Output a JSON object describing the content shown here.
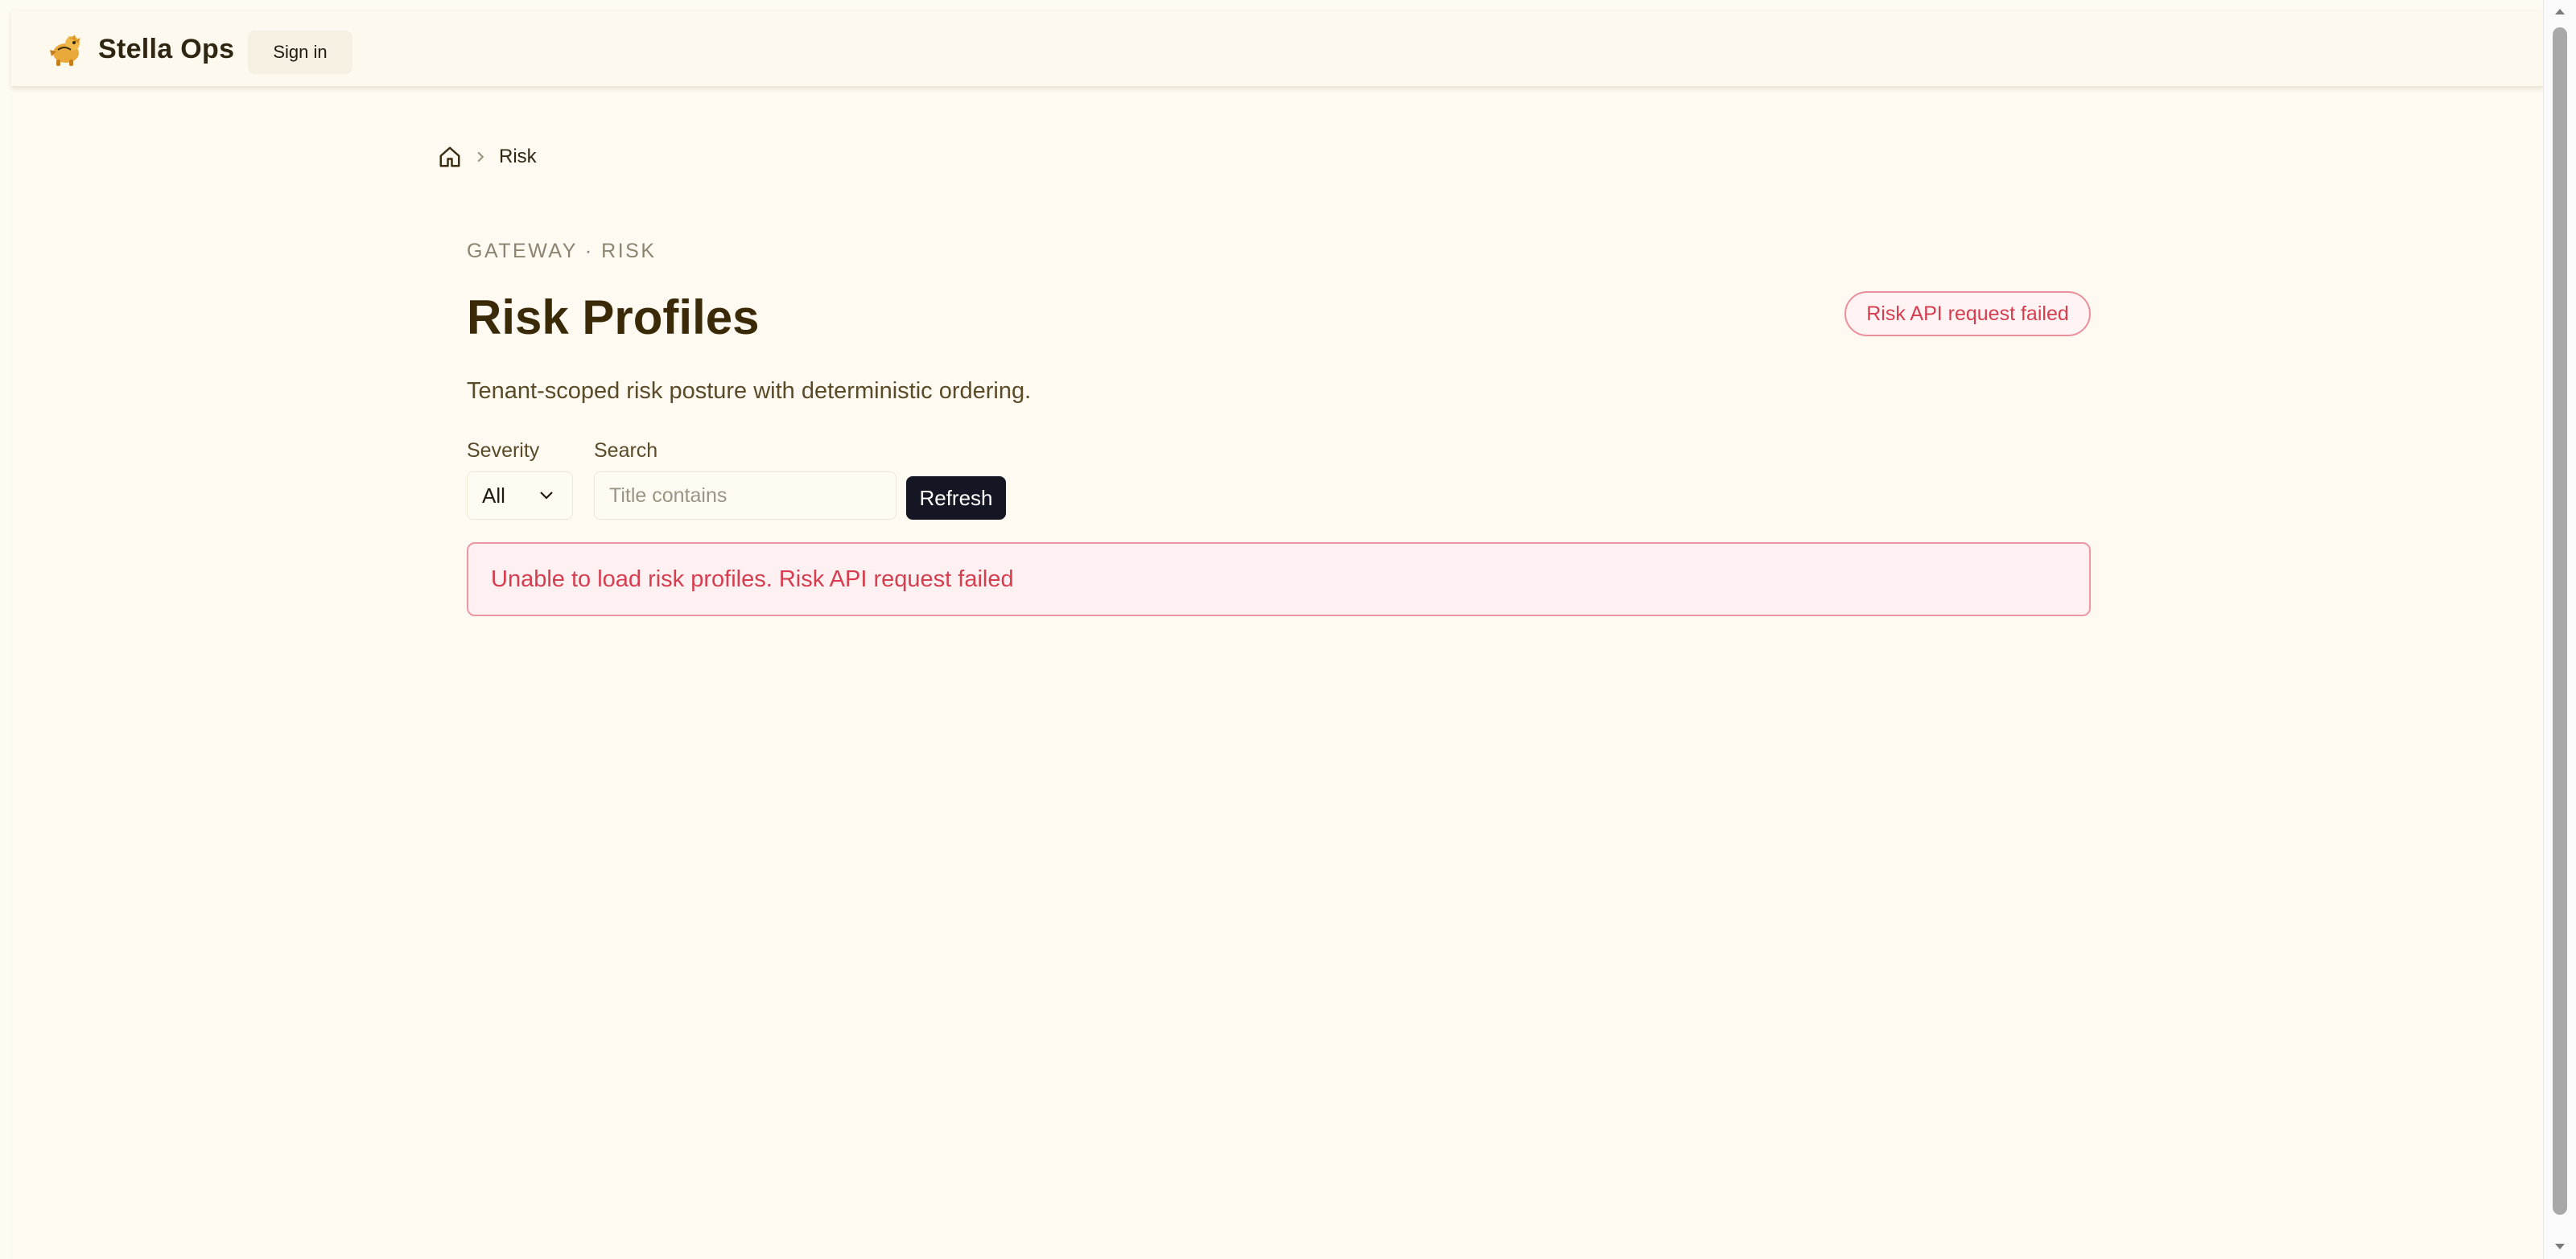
{
  "header": {
    "brand_name": "Stella Ops",
    "brand_icon": "mascot-logo-icon",
    "signin_label": "Sign in"
  },
  "breadcrumb": {
    "home_icon": "home-icon",
    "current": "Risk"
  },
  "page": {
    "eyebrow": "GATEWAY · RISK",
    "title": "Risk Profiles",
    "subtitle": "Tenant-scoped risk posture with deterministic ordering.",
    "status_badge": "Risk API request failed"
  },
  "filters": {
    "severity_label": "Severity",
    "severity_value": "All",
    "search_label": "Search",
    "search_placeholder": "Title contains",
    "search_value": "",
    "refresh_label": "Refresh"
  },
  "alert": {
    "message": "Unable to load risk profiles. Risk API request failed"
  },
  "colors": {
    "background": "#fefaf2",
    "error": "#d63d4f",
    "error_border": "#ec98a3",
    "primary_button": "#141723",
    "title": "#3b2a08"
  }
}
